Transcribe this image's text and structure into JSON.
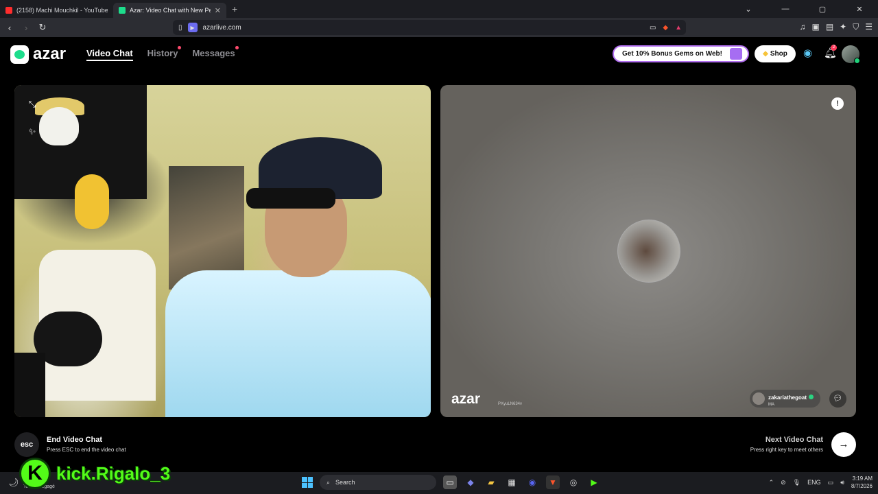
{
  "browser": {
    "tabs": [
      {
        "title": "(2158) Machi Mouchkil - YouTube",
        "favicon_color": "#ff2d2d",
        "active": false
      },
      {
        "title": "Azar: Video Chat with New Pe",
        "favicon_color": "#1ddd8c",
        "active": true
      }
    ],
    "new_tab": "+",
    "url": "azarlive.com"
  },
  "azar": {
    "logo": "azar",
    "nav": [
      {
        "label": "Video Chat",
        "active": true
      },
      {
        "label": "History",
        "dot": true
      },
      {
        "label": "Messages",
        "dot": true
      }
    ],
    "promo_label": "Get 10% Bonus Gems on Web!",
    "shop_label": "Shop",
    "notification_count": "2",
    "brand_color": "#1ddd8c",
    "accent_color": "#b26ef0"
  },
  "remote": {
    "watermark": "azar",
    "watermark_id": "PXyuLN634v",
    "username": "zakariathegoat",
    "country": "MA"
  },
  "controls": {
    "esc_key": "esc",
    "end_title": "End Video Chat",
    "end_sub": "Press ESC to end the video chat",
    "next_title": "Next Video Chat",
    "next_sub": "Press right key to meet others"
  },
  "overlay": {
    "kick_letter": "K",
    "kick_name": "kick.Rigalo_3"
  },
  "taskbar": {
    "weather_sub": "Temps dégagé",
    "search_label": "Search",
    "language": "ENG",
    "time": "3:19 AM",
    "date": "8/7/2026"
  }
}
